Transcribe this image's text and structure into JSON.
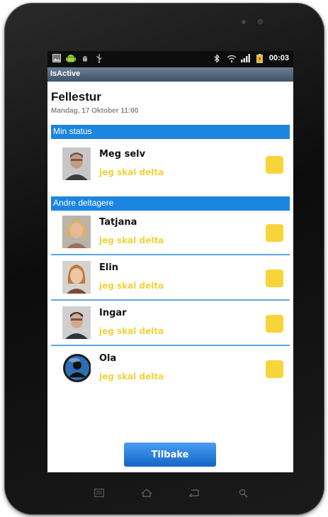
{
  "statusbar": {
    "time": "00:03",
    "left_icons": [
      "image-icon",
      "android-icon",
      "usb-debug-icon",
      "usb-icon"
    ],
    "right_icons": [
      "bluetooth-icon",
      "wifi-icon",
      "signal-icon",
      "battery-icon"
    ]
  },
  "app": {
    "title": "IsActive"
  },
  "event": {
    "title": "Fellestur",
    "date": "Mandag, 17 Oktober 11:00"
  },
  "sections": {
    "my_status": "Min status",
    "others": "Andre deltagere"
  },
  "me": {
    "name": "Meg selv",
    "status": "jeg skal delta",
    "checked_color": "#f7d53a"
  },
  "participants": [
    {
      "name": "Tatjana",
      "status": "jeg skal delta"
    },
    {
      "name": "Elin",
      "status": "jeg skal delta"
    },
    {
      "name": "Ingar",
      "status": "jeg skal delta"
    },
    {
      "name": "Ola",
      "status": "jeg skal delta"
    }
  ],
  "back_button": {
    "label": "Tilbake"
  },
  "colors": {
    "accent": "#1b85e0",
    "status_text": "#f3d23a",
    "checkbox": "#f7d53a"
  },
  "nav_keys": [
    "menu-icon",
    "home-icon",
    "back-icon",
    "search-icon"
  ]
}
